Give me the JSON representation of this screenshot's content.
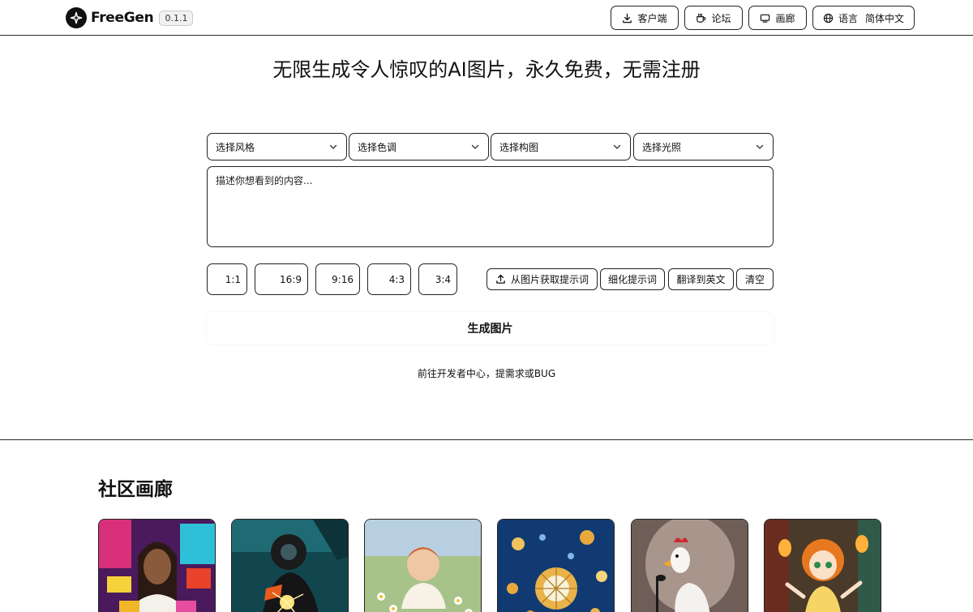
{
  "header": {
    "brand": "FreeGen",
    "version": "0.1.1",
    "buttons": {
      "client": "客户端",
      "forum": "论坛",
      "gallery": "画廊",
      "language_label": "语言",
      "language_value": "简体中文"
    }
  },
  "hero": {
    "title": "无限生成令人惊叹的AI图片，永久免费，无需注册"
  },
  "selects": {
    "style": "选择风格",
    "tone": "选择色调",
    "composition": "选择构图",
    "lighting": "选择光照"
  },
  "prompt": {
    "placeholder": "描述你想看到的内容..."
  },
  "ratios": [
    "1:1",
    "16:9",
    "9:16",
    "4:3",
    "3:4"
  ],
  "tools": {
    "from_image": "从图片获取提示词",
    "refine": "细化提示词",
    "translate": "翻译到英文",
    "clear": "清空"
  },
  "generate_label": "生成图片",
  "dev_link": "前往开发者中心，提需求或BUG",
  "gallery": {
    "title": "社区画廊"
  },
  "icons": {
    "logo": "sparkle-icon",
    "client": "download-icon",
    "forum": "coffee-cup-icon",
    "gallery": "monitor-icon",
    "language": "globe-icon",
    "select": "chevron-down-icon",
    "upload": "upload-icon"
  }
}
